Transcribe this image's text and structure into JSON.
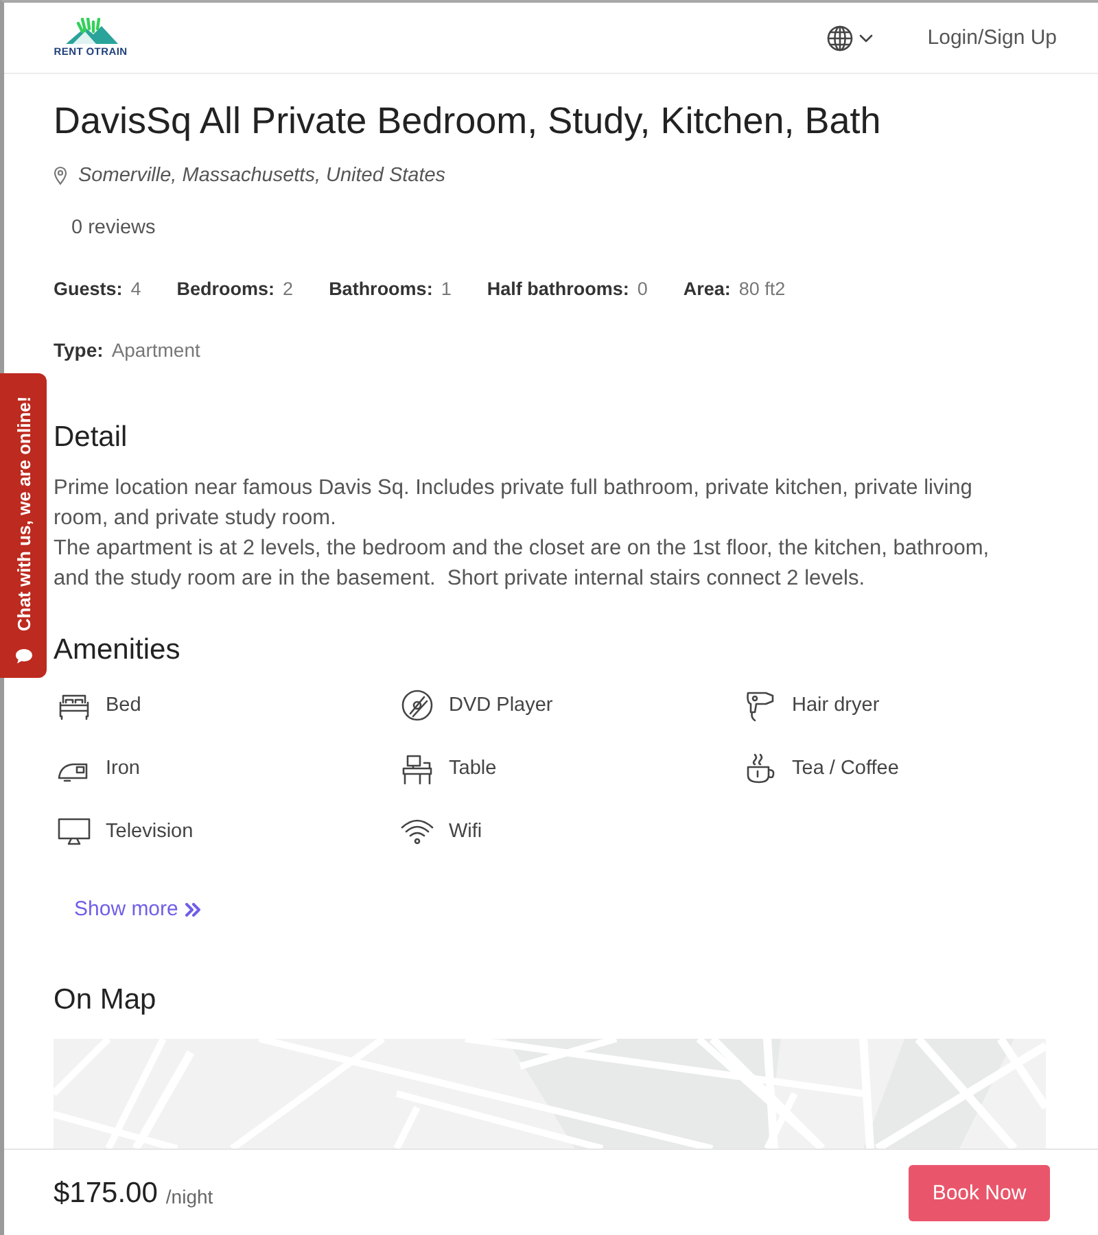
{
  "header": {
    "logo_text": "RENT OTRAIN",
    "login": "Login/Sign Up"
  },
  "listing": {
    "title": "DavisSq All Private Bedroom, Study, Kitchen, Bath",
    "location": "Somerville, Massachusetts, United States",
    "reviews": "0 reviews",
    "specs": [
      {
        "label": "Guests:",
        "value": "4"
      },
      {
        "label": "Bedrooms:",
        "value": "2"
      },
      {
        "label": "Bathrooms:",
        "value": "1"
      },
      {
        "label": "Half bathrooms:",
        "value": "0"
      },
      {
        "label": "Area:",
        "value": "80 ft2"
      }
    ],
    "type": {
      "label": "Type:",
      "value": "Apartment"
    }
  },
  "detail": {
    "heading": "Detail",
    "paragraphs": [
      "Prime location near famous Davis Sq. Includes private full bathroom, private kitchen, private living room, and private study room.",
      "The apartment is at 2 levels, the bedroom and the closet are on the 1st floor, the kitchen, bathroom, and the study room are in the basement.  Short private internal stairs connect 2 levels."
    ]
  },
  "amenities": {
    "heading": "Amenities",
    "items": [
      "Bed",
      "DVD Player",
      "Hair dryer",
      "Iron",
      "Table",
      "Tea / Coffee",
      "Television",
      "Wifi"
    ],
    "show_more": "Show more"
  },
  "map": {
    "heading": "On Map"
  },
  "booking_bar": {
    "price": "$175.00",
    "unit": "/night",
    "button": "Book Now"
  },
  "chat_tab": {
    "label": "Chat with us, we are online!"
  }
}
